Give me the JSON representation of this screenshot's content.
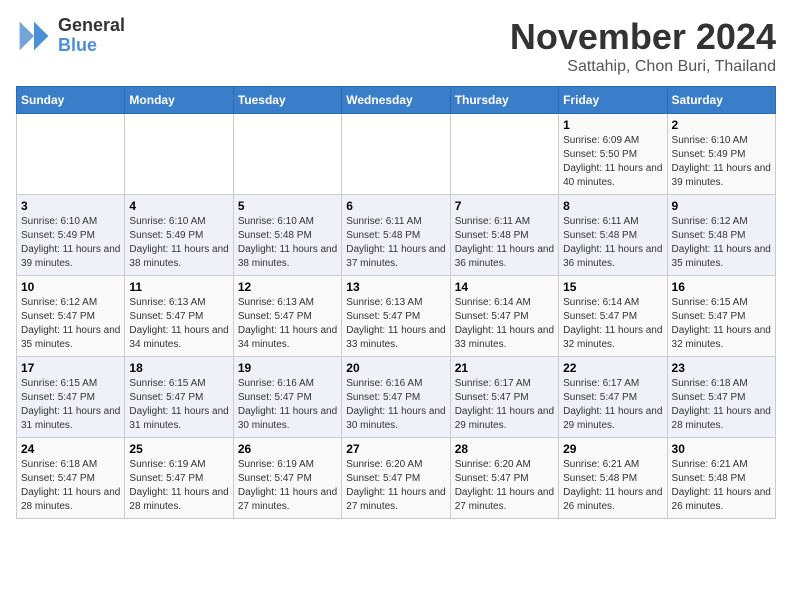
{
  "header": {
    "logo": {
      "general": "General",
      "blue": "Blue"
    },
    "title": "November 2024",
    "location": "Sattahip, Chon Buri, Thailand"
  },
  "weekdays": [
    "Sunday",
    "Monday",
    "Tuesday",
    "Wednesday",
    "Thursday",
    "Friday",
    "Saturday"
  ],
  "weeks": [
    [
      {
        "day": "",
        "sunrise": "",
        "sunset": "",
        "daylight": ""
      },
      {
        "day": "",
        "sunrise": "",
        "sunset": "",
        "daylight": ""
      },
      {
        "day": "",
        "sunrise": "",
        "sunset": "",
        "daylight": ""
      },
      {
        "day": "",
        "sunrise": "",
        "sunset": "",
        "daylight": ""
      },
      {
        "day": "",
        "sunrise": "",
        "sunset": "",
        "daylight": ""
      },
      {
        "day": "1",
        "sunrise": "Sunrise: 6:09 AM",
        "sunset": "Sunset: 5:50 PM",
        "daylight": "Daylight: 11 hours and 40 minutes."
      },
      {
        "day": "2",
        "sunrise": "Sunrise: 6:10 AM",
        "sunset": "Sunset: 5:49 PM",
        "daylight": "Daylight: 11 hours and 39 minutes."
      }
    ],
    [
      {
        "day": "3",
        "sunrise": "Sunrise: 6:10 AM",
        "sunset": "Sunset: 5:49 PM",
        "daylight": "Daylight: 11 hours and 39 minutes."
      },
      {
        "day": "4",
        "sunrise": "Sunrise: 6:10 AM",
        "sunset": "Sunset: 5:49 PM",
        "daylight": "Daylight: 11 hours and 38 minutes."
      },
      {
        "day": "5",
        "sunrise": "Sunrise: 6:10 AM",
        "sunset": "Sunset: 5:48 PM",
        "daylight": "Daylight: 11 hours and 38 minutes."
      },
      {
        "day": "6",
        "sunrise": "Sunrise: 6:11 AM",
        "sunset": "Sunset: 5:48 PM",
        "daylight": "Daylight: 11 hours and 37 minutes."
      },
      {
        "day": "7",
        "sunrise": "Sunrise: 6:11 AM",
        "sunset": "Sunset: 5:48 PM",
        "daylight": "Daylight: 11 hours and 36 minutes."
      },
      {
        "day": "8",
        "sunrise": "Sunrise: 6:11 AM",
        "sunset": "Sunset: 5:48 PM",
        "daylight": "Daylight: 11 hours and 36 minutes."
      },
      {
        "day": "9",
        "sunrise": "Sunrise: 6:12 AM",
        "sunset": "Sunset: 5:48 PM",
        "daylight": "Daylight: 11 hours and 35 minutes."
      }
    ],
    [
      {
        "day": "10",
        "sunrise": "Sunrise: 6:12 AM",
        "sunset": "Sunset: 5:47 PM",
        "daylight": "Daylight: 11 hours and 35 minutes."
      },
      {
        "day": "11",
        "sunrise": "Sunrise: 6:13 AM",
        "sunset": "Sunset: 5:47 PM",
        "daylight": "Daylight: 11 hours and 34 minutes."
      },
      {
        "day": "12",
        "sunrise": "Sunrise: 6:13 AM",
        "sunset": "Sunset: 5:47 PM",
        "daylight": "Daylight: 11 hours and 34 minutes."
      },
      {
        "day": "13",
        "sunrise": "Sunrise: 6:13 AM",
        "sunset": "Sunset: 5:47 PM",
        "daylight": "Daylight: 11 hours and 33 minutes."
      },
      {
        "day": "14",
        "sunrise": "Sunrise: 6:14 AM",
        "sunset": "Sunset: 5:47 PM",
        "daylight": "Daylight: 11 hours and 33 minutes."
      },
      {
        "day": "15",
        "sunrise": "Sunrise: 6:14 AM",
        "sunset": "Sunset: 5:47 PM",
        "daylight": "Daylight: 11 hours and 32 minutes."
      },
      {
        "day": "16",
        "sunrise": "Sunrise: 6:15 AM",
        "sunset": "Sunset: 5:47 PM",
        "daylight": "Daylight: 11 hours and 32 minutes."
      }
    ],
    [
      {
        "day": "17",
        "sunrise": "Sunrise: 6:15 AM",
        "sunset": "Sunset: 5:47 PM",
        "daylight": "Daylight: 11 hours and 31 minutes."
      },
      {
        "day": "18",
        "sunrise": "Sunrise: 6:15 AM",
        "sunset": "Sunset: 5:47 PM",
        "daylight": "Daylight: 11 hours and 31 minutes."
      },
      {
        "day": "19",
        "sunrise": "Sunrise: 6:16 AM",
        "sunset": "Sunset: 5:47 PM",
        "daylight": "Daylight: 11 hours and 30 minutes."
      },
      {
        "day": "20",
        "sunrise": "Sunrise: 6:16 AM",
        "sunset": "Sunset: 5:47 PM",
        "daylight": "Daylight: 11 hours and 30 minutes."
      },
      {
        "day": "21",
        "sunrise": "Sunrise: 6:17 AM",
        "sunset": "Sunset: 5:47 PM",
        "daylight": "Daylight: 11 hours and 29 minutes."
      },
      {
        "day": "22",
        "sunrise": "Sunrise: 6:17 AM",
        "sunset": "Sunset: 5:47 PM",
        "daylight": "Daylight: 11 hours and 29 minutes."
      },
      {
        "day": "23",
        "sunrise": "Sunrise: 6:18 AM",
        "sunset": "Sunset: 5:47 PM",
        "daylight": "Daylight: 11 hours and 28 minutes."
      }
    ],
    [
      {
        "day": "24",
        "sunrise": "Sunrise: 6:18 AM",
        "sunset": "Sunset: 5:47 PM",
        "daylight": "Daylight: 11 hours and 28 minutes."
      },
      {
        "day": "25",
        "sunrise": "Sunrise: 6:19 AM",
        "sunset": "Sunset: 5:47 PM",
        "daylight": "Daylight: 11 hours and 28 minutes."
      },
      {
        "day": "26",
        "sunrise": "Sunrise: 6:19 AM",
        "sunset": "Sunset: 5:47 PM",
        "daylight": "Daylight: 11 hours and 27 minutes."
      },
      {
        "day": "27",
        "sunrise": "Sunrise: 6:20 AM",
        "sunset": "Sunset: 5:47 PM",
        "daylight": "Daylight: 11 hours and 27 minutes."
      },
      {
        "day": "28",
        "sunrise": "Sunrise: 6:20 AM",
        "sunset": "Sunset: 5:47 PM",
        "daylight": "Daylight: 11 hours and 27 minutes."
      },
      {
        "day": "29",
        "sunrise": "Sunrise: 6:21 AM",
        "sunset": "Sunset: 5:48 PM",
        "daylight": "Daylight: 11 hours and 26 minutes."
      },
      {
        "day": "30",
        "sunrise": "Sunrise: 6:21 AM",
        "sunset": "Sunset: 5:48 PM",
        "daylight": "Daylight: 11 hours and 26 minutes."
      }
    ]
  ]
}
